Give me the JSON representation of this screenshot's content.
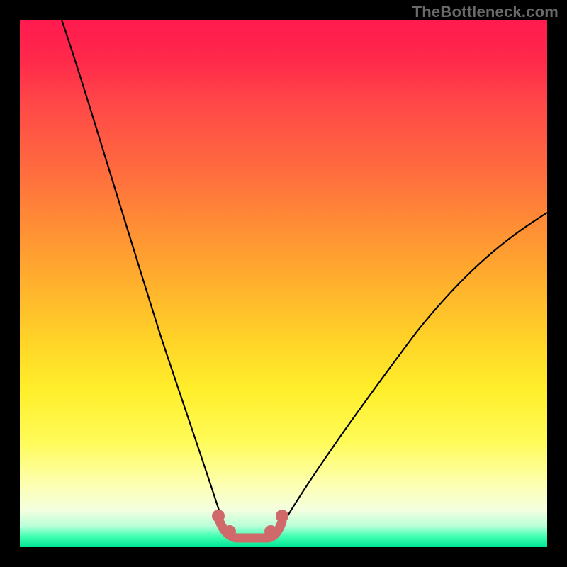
{
  "watermark": "TheBottleneck.com",
  "chart_data": {
    "type": "line",
    "title": "",
    "xlabel": "",
    "ylabel": "",
    "xlim": [
      0,
      100
    ],
    "ylim": [
      0,
      100
    ],
    "grid": false,
    "legend": false,
    "background_gradient": {
      "orientation": "vertical",
      "stops": [
        {
          "pos": 0.0,
          "color": "#ff1a4f"
        },
        {
          "pos": 0.3,
          "color": "#ff7a38"
        },
        {
          "pos": 0.6,
          "color": "#ffd128"
        },
        {
          "pos": 0.85,
          "color": "#fffec0"
        },
        {
          "pos": 0.97,
          "color": "#8affc0"
        },
        {
          "pos": 1.0,
          "color": "#00e695"
        }
      ]
    },
    "series": [
      {
        "name": "left_curve",
        "stroke": "#000000",
        "x": [
          8,
          12,
          16,
          20,
          24,
          28,
          32,
          35,
          37,
          39
        ],
        "y": [
          100,
          88,
          74,
          60,
          46,
          33,
          20,
          10,
          4,
          0
        ]
      },
      {
        "name": "right_curve",
        "stroke": "#000000",
        "x": [
          49,
          52,
          56,
          62,
          70,
          80,
          90,
          100
        ],
        "y": [
          0,
          4,
          10,
          18,
          28,
          40,
          52,
          63
        ]
      },
      {
        "name": "optimal_flat_region",
        "stroke": "#d06a6a",
        "x": [
          38,
          40,
          44,
          47,
          49
        ],
        "y": [
          2,
          0,
          0,
          0,
          2
        ]
      }
    ],
    "markers": [
      {
        "x": 37.5,
        "y": 3.0,
        "r": 1.2,
        "color": "#d06a6a"
      },
      {
        "x": 39.5,
        "y": 1.0,
        "r": 1.2,
        "color": "#d06a6a"
      },
      {
        "x": 47.0,
        "y": 1.0,
        "r": 1.2,
        "color": "#d06a6a"
      },
      {
        "x": 49.0,
        "y": 3.0,
        "r": 1.2,
        "color": "#d06a6a"
      }
    ],
    "notes": "V-shaped bottleneck curve; y-axis represents bottleneck percentage (high=red, low=green). Minimum (~0%) occurs on the flat pink segment around x≈38–49."
  }
}
